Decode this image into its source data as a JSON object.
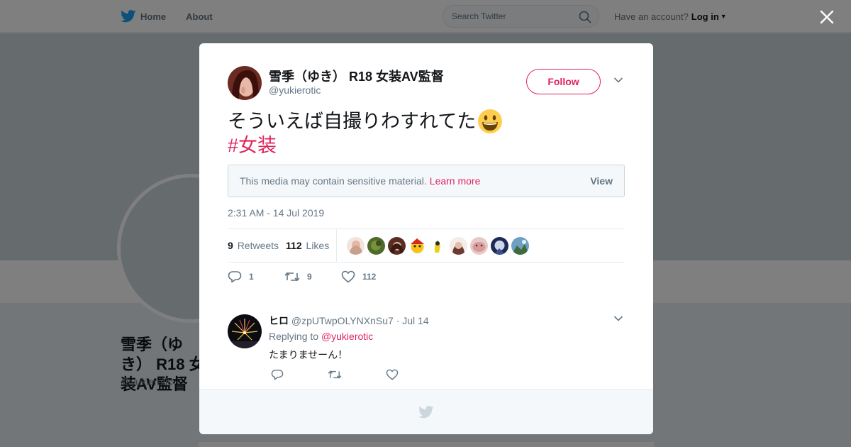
{
  "topbar": {
    "nav": [
      {
        "label": "Home",
        "icon": "twitter-bird-icon"
      },
      {
        "label": "About"
      }
    ],
    "search": {
      "placeholder": "Search Twitter",
      "icon": "search-icon"
    },
    "account_prompt": "Have an account?",
    "login_label": "Log in",
    "brand_color": "#1da1f2"
  },
  "background_profile": {
    "name": "雪季（ゆき） R18 女装AV監督",
    "handle": "@yukierotic"
  },
  "tweet": {
    "author_name": "雪季（ゆき） R18 女装AV監督",
    "author_handle": "@yukierotic",
    "follow_label": "Follow",
    "text": "そういえば自撮りわすれてた",
    "emoji": "😃",
    "hashtag": "#女装",
    "sensitive_notice": "This media may contain sensitive material.",
    "learn_more_label": "Learn more",
    "view_label": "View",
    "timestamp": "2:31 AM - 14 Jul 2019",
    "retweets_count": "9",
    "retweets_label": "Retweets",
    "likes_count": "112",
    "likes_label": "Likes",
    "actions": {
      "replies": "1",
      "retweets": "9",
      "likes": "112"
    },
    "accent_color": "#e0245e"
  },
  "reply": {
    "name": "ヒロ",
    "handle": "@zpUTwpOLYNXnSu7",
    "separator": "·",
    "date": "Jul 14",
    "replying_prefix": "Replying to",
    "replying_to": "@yukierotic",
    "text": "たまりませーん！"
  }
}
